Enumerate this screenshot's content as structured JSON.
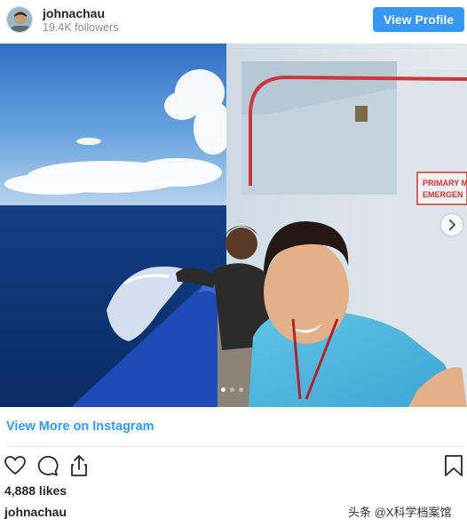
{
  "header": {
    "username": "johnachau",
    "followers": "19.4K followers",
    "view_profile_label": "View Profile"
  },
  "post": {
    "image_alt": "Selfie of two men on the deck of a ship at sea",
    "sign_lines": [
      "PRIMARY M",
      "EMERGEN"
    ],
    "carousel": {
      "count": 3,
      "active_index": 0
    }
  },
  "view_more_label": "View More on Instagram",
  "actions": {
    "icons": [
      "heart-icon",
      "comment-icon",
      "share-icon",
      "bookmark-icon"
    ]
  },
  "likes": "4,888 likes",
  "caption_username": "johnachau",
  "watermark": "头条 @X科学档案馆",
  "colors": {
    "accent": "#3897f0",
    "text": "#262626",
    "muted": "#8e8e8e"
  }
}
